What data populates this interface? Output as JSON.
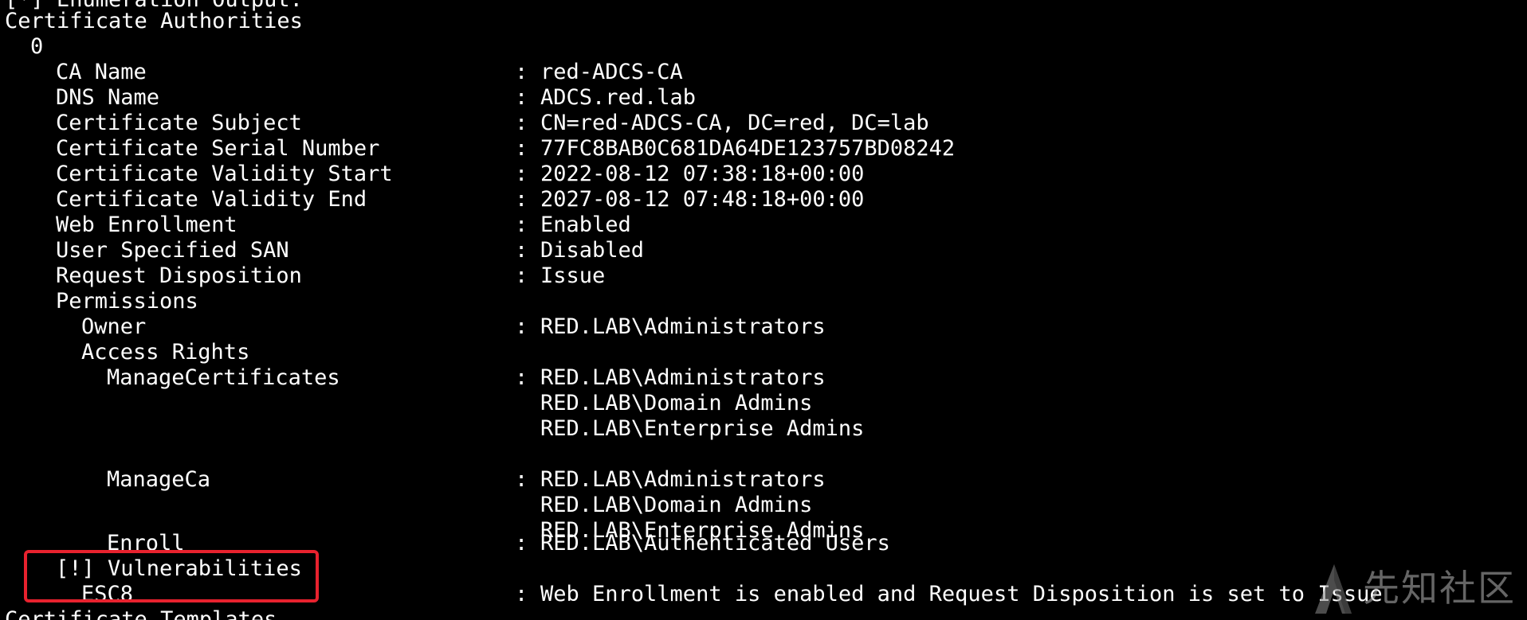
{
  "terminal": {
    "top_line": "[*] Enumeration Output:",
    "section_title": "Certificate Authorities",
    "ca_index": "0",
    "separator": ":",
    "fields": {
      "ca_name": {
        "label": "CA Name",
        "value": "red-ADCS-CA"
      },
      "dns_name": {
        "label": "DNS Name",
        "value": "ADCS.red.lab"
      },
      "cert_subject": {
        "label": "Certificate Subject",
        "value": "CN=red-ADCS-CA, DC=red, DC=lab"
      },
      "cert_serial": {
        "label": "Certificate Serial Number",
        "value": "77FC8BAB0C681DA64DE123757BD08242"
      },
      "validity_start": {
        "label": "Certificate Validity Start",
        "value": "2022-08-12 07:38:18+00:00"
      },
      "validity_end": {
        "label": "Certificate Validity End",
        "value": "2027-08-12 07:48:18+00:00"
      },
      "web_enrollment": {
        "label": "Web Enrollment",
        "value": "Enabled"
      },
      "user_specified_san": {
        "label": "User Specified SAN",
        "value": "Disabled"
      },
      "request_disposition": {
        "label": "Request Disposition",
        "value": "Issue"
      }
    },
    "permissions": {
      "label": "Permissions",
      "owner": {
        "label": "Owner",
        "value": "RED.LAB\\Administrators"
      },
      "access_rights_label": "Access Rights",
      "manage_certificates": {
        "label": "ManageCertificates",
        "values": [
          "RED.LAB\\Administrators",
          "RED.LAB\\Domain Admins",
          "RED.LAB\\Enterprise Admins"
        ]
      },
      "manage_ca": {
        "label": "ManageCa",
        "values": [
          "RED.LAB\\Administrators",
          "RED.LAB\\Domain Admins",
          "RED.LAB\\Enterprise Admins"
        ]
      },
      "enroll": {
        "label": "Enroll",
        "value": "RED.LAB\\Authenticated Users"
      }
    },
    "vulnerabilities": {
      "label": "[!] Vulnerabilities",
      "esc8": {
        "label": "ESC8",
        "value": "Web Enrollment is enabled and Request Disposition is set to Issue"
      }
    },
    "next_section": "Certificate Templates"
  },
  "colors": {
    "background": "#000000",
    "text": "#ffffff",
    "highlight_border": "#e8222e"
  },
  "watermark": {
    "text": "先知社区",
    "icon": "xianzhi-logo-icon"
  }
}
